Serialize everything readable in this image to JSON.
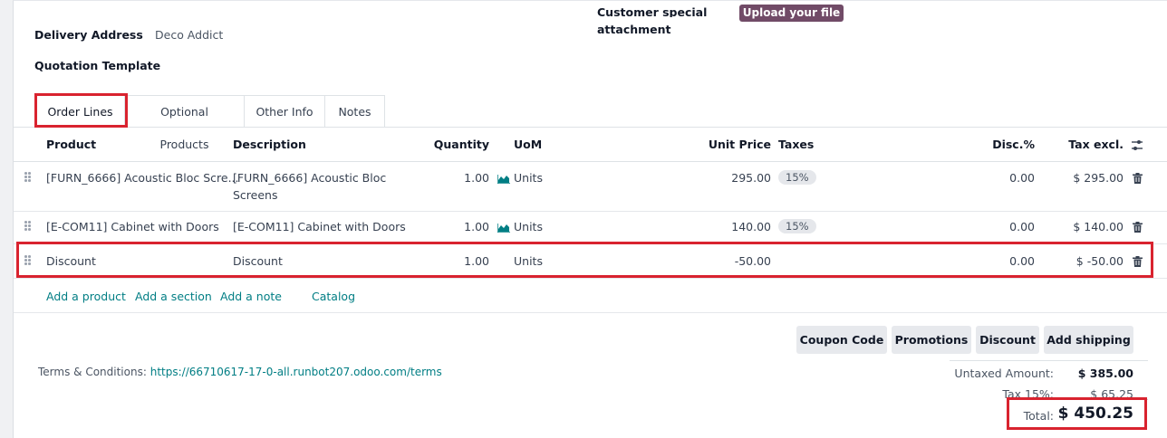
{
  "form": {
    "customer_special_label": "Customer special",
    "attachment_label": "attachment",
    "upload_label": "Upload your file",
    "delivery_address_label": "Delivery Address",
    "delivery_address_value": "Deco Addict",
    "quotation_template_label": "Quotation Template"
  },
  "tabs": [
    "Order Lines",
    "Optional Products",
    "Other Info",
    "Notes"
  ],
  "columns": {
    "product": "Product",
    "description": "Description",
    "quantity": "Quantity",
    "uom": "UoM",
    "unit_price": "Unit Price",
    "taxes": "Taxes",
    "disc": "Disc.%",
    "tax_excl": "Tax excl."
  },
  "lines": [
    {
      "product": "[FURN_6666] Acoustic Bloc Scre...",
      "description_1": "[FURN_6666] Acoustic Bloc",
      "description_2": "Screens",
      "quantity": "1.00",
      "uom": "Units",
      "unit_price": "295.00",
      "tax": "15%",
      "disc": "0.00",
      "subtotal": "$ 295.00"
    },
    {
      "product": "[E-COM11] Cabinet with Doors",
      "description_1": "[E-COM11] Cabinet with Doors",
      "quantity": "1.00",
      "uom": "Units",
      "unit_price": "140.00",
      "tax": "15%",
      "disc": "0.00",
      "subtotal": "$ 140.00"
    },
    {
      "product": "Discount",
      "description_1": "Discount",
      "quantity": "1.00",
      "uom": "Units",
      "unit_price": "-50.00",
      "disc": "0.00",
      "subtotal": "$ -50.00"
    }
  ],
  "add_links": {
    "product": "Add a product",
    "section": "Add a section",
    "note": "Add a note",
    "catalog": "Catalog"
  },
  "buttons": {
    "coupon": "Coupon Code",
    "promotions": "Promotions",
    "discount": "Discount",
    "shipping": "Add shipping"
  },
  "terms": {
    "label": "Terms & Conditions:",
    "url": "https://66710617-17-0-all.runbot207.odoo.com/terms"
  },
  "totals": {
    "untaxed_label": "Untaxed Amount:",
    "untaxed_value": "$ 385.00",
    "tax_label": "Tax 15%:",
    "tax_value": "$ 65.25",
    "total_label": "Total:",
    "total_value": "$ 450.25"
  },
  "colors": {
    "brand": "#714b67",
    "link": "#017e84",
    "highlight": "#d9232f",
    "forecast_icon": "#017e84"
  },
  "icons": {
    "drag_handle": "drag-handle-icon",
    "forecast": "area-chart-icon",
    "delete": "trash-icon",
    "column_settings": "sliders-icon"
  }
}
